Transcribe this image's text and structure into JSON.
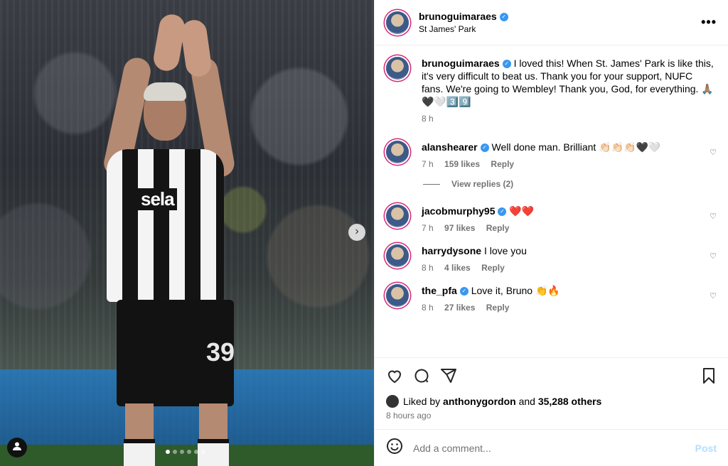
{
  "post": {
    "author": "brunoguimaraes",
    "location": "St James' Park",
    "more_label": "•••",
    "next_label": "›",
    "user_tag_icon": "person-icon",
    "carousel_dots": [
      true,
      false,
      false,
      false,
      false,
      false
    ],
    "jersey_sponsor": "sela",
    "jersey_number": "39"
  },
  "caption": {
    "author": "brunoguimaraes",
    "text": "I loved this! When St. James' Park is like this, it's very difficult to beat us. Thank you for your support, NUFC fans. We're going to Wembley! Thank you, God, for everything. 🙏🏽🖤🤍3️⃣9️⃣",
    "time": "8 h"
  },
  "comments": [
    {
      "author": "alanshearer",
      "verified": true,
      "text": "Well done man. Brilliant 👏🏻👏🏻👏🏻🖤🤍",
      "time": "7 h",
      "likes": "159 likes",
      "reply": "Reply",
      "view_replies": "View replies (2)"
    },
    {
      "author": "jacobmurphy95",
      "verified": true,
      "text": "❤️❤️",
      "time": "7 h",
      "likes": "97 likes",
      "reply": "Reply"
    },
    {
      "author": "harrydysone",
      "verified": false,
      "text": "I love you",
      "time": "8 h",
      "likes": "4 likes",
      "reply": "Reply"
    },
    {
      "author": "the_pfa",
      "verified": true,
      "text": "Love it, Bruno 👏🔥",
      "time": "8 h",
      "likes": "27 likes",
      "reply": "Reply"
    }
  ],
  "actions": {
    "liked_by_prefix": "Liked by",
    "liked_by_user": "anthonygordon",
    "liked_by_and": "and",
    "liked_by_count": "35,288 others",
    "posted_ago": "8 hours ago"
  },
  "add_comment": {
    "placeholder": "Add a comment...",
    "post_label": "Post"
  },
  "colors": {
    "verified": "#3897f0",
    "post_disabled": "#b2dffc",
    "meta_gray": "#737373"
  }
}
